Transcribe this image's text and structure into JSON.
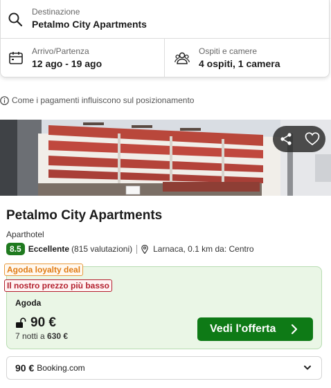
{
  "search": {
    "destination_label": "Destinazione",
    "destination_value": "Petalmo City Apartments",
    "dates_label": "Arrivo/Partenza",
    "dates_value": "12 ago - 19 ago",
    "guests_label": "Ospiti e camere",
    "guests_value": "4 ospiti, 1 camera"
  },
  "payment_note": "Come i pagamenti influiscono sul posizionamento",
  "hotel": {
    "name": "Petalmo City Apartments",
    "type": "Aparthotel",
    "score": "8.5",
    "rating_word": "Eccellente",
    "reviews": "(815 valutazioni)",
    "location": "Larnaca, 0.1 km da: Centro"
  },
  "offer": {
    "loyalty_badge": "Agoda loyalty deal",
    "price_badge": "Il nostro prezzo più basso",
    "provider": "Agoda",
    "price": "90 €",
    "nights_text": "7 notti a",
    "total": "630 €",
    "cta_label": "Vedi l'offerta"
  },
  "alt_provider": {
    "price": "90 €",
    "name": "Booking.com"
  },
  "icons": {
    "search": "search-icon",
    "calendar": "calendar-icon",
    "guests": "guests-icon",
    "info": "info-icon",
    "share": "share-icon",
    "heart": "heart-icon",
    "pin": "location-pin-icon",
    "lock": "unlock-icon",
    "chevron_right": "chevron-right-icon",
    "chevron_down": "chevron-down-icon"
  },
  "colors": {
    "score_badge": "#1f7a1f",
    "cta": "#0e7a16",
    "offer_bg": "#eaf6e6",
    "loyalty": "#e07b12",
    "lowest_price": "#b3202e"
  }
}
